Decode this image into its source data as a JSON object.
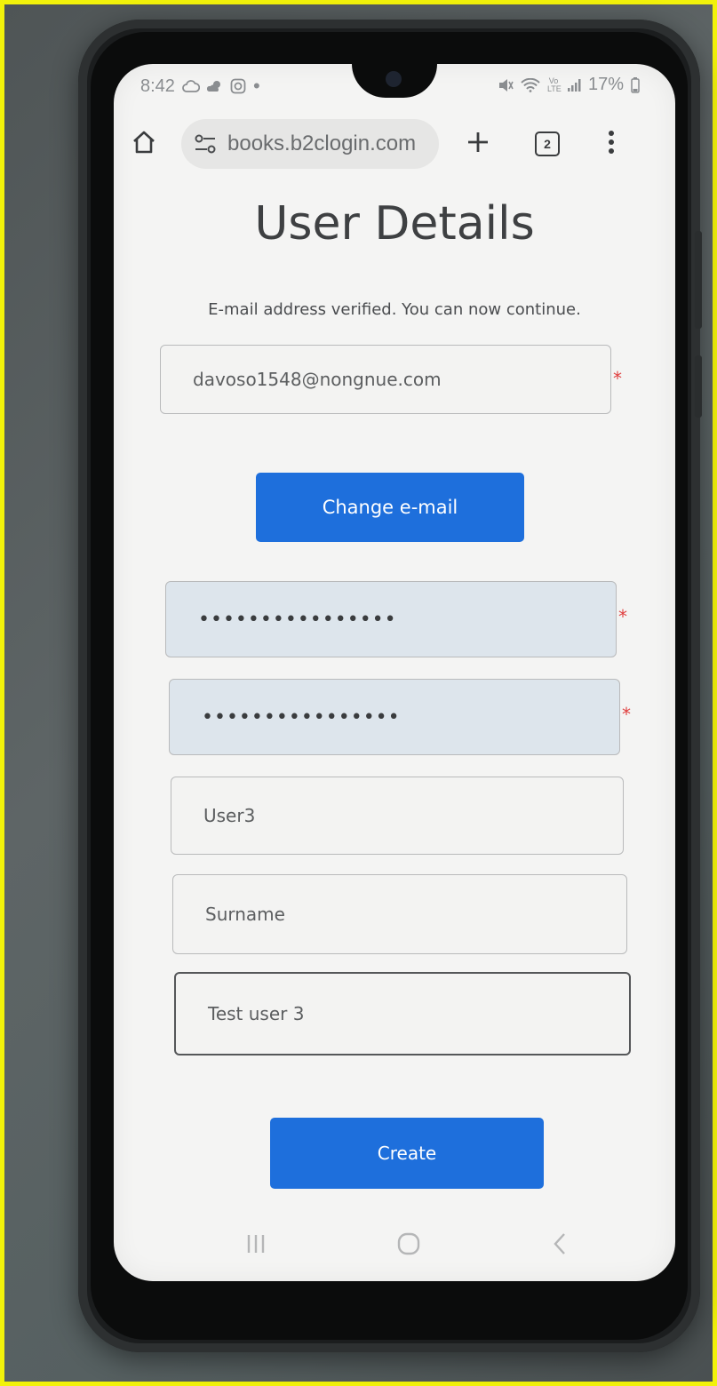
{
  "status_bar": {
    "time": "8:42",
    "notification_icons": [
      "cloud-icon",
      "weather-icon",
      "instagram-icon",
      "dot-icon"
    ],
    "battery": "17%",
    "system_icons": [
      "mute-icon",
      "wifi-icon",
      "volte-icon",
      "signal-icon",
      "battery-icon"
    ]
  },
  "browser": {
    "url": "books.b2clogin.com",
    "tab_count": "2"
  },
  "page": {
    "title": "User Details",
    "verified_message": "E-mail address verified. You can now continue.",
    "email_value": "davoso1548@nongnue.com",
    "change_email_label": "Change e-mail",
    "new_password_masked": "••••••••••••••••",
    "confirm_password_masked": "••••••••••••••••",
    "given_name_value": "User3",
    "surname_placeholder": "Surname",
    "display_name_value": "Test user 3",
    "create_label": "Create",
    "required_marker": "*"
  },
  "colors": {
    "primary_button": "#1e6fdc",
    "required": "#e04040",
    "autofill_bg": "#dde5ec"
  }
}
